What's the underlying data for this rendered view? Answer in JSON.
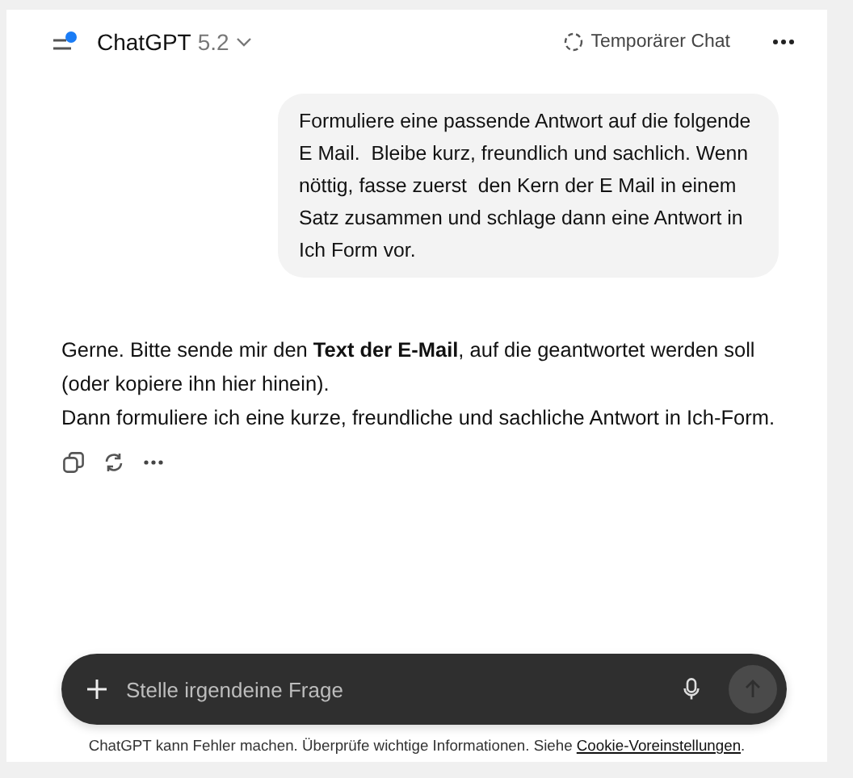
{
  "header": {
    "title": "ChatGPT",
    "version": "5.2",
    "notification": true,
    "temporary_chat": "Temporärer Chat"
  },
  "messages": [
    {
      "kind": "user",
      "text": "Formuliere eine passende Antwort auf die folgende E Mail.  Bleibe kurz, freundlich und sachlich. Wenn nöttig, fasse zuerst  den Kern der E Mail in einem Satz zusammen und schlage dann eine Antwort in Ich Form vor."
    },
    {
      "kind": "assistant",
      "paragraphs": [
        "Gerne. Bitte sende mir den **Text der E-Mail**, auf die geantwortet werden soll (oder kopiere ihn hier hinein).",
        "Dann formuliere ich eine kurze, freundliche und sachliche Antwort in Ich-Form."
      ]
    }
  ],
  "composer": {
    "placeholder": "Stelle irgendeine Frage"
  },
  "footer": {
    "text": "ChatGPT kann Fehler machen. Überprüfe wichtige Informationen. Siehe ",
    "link": "Cookie-Voreinstellungen",
    "end": "."
  }
}
